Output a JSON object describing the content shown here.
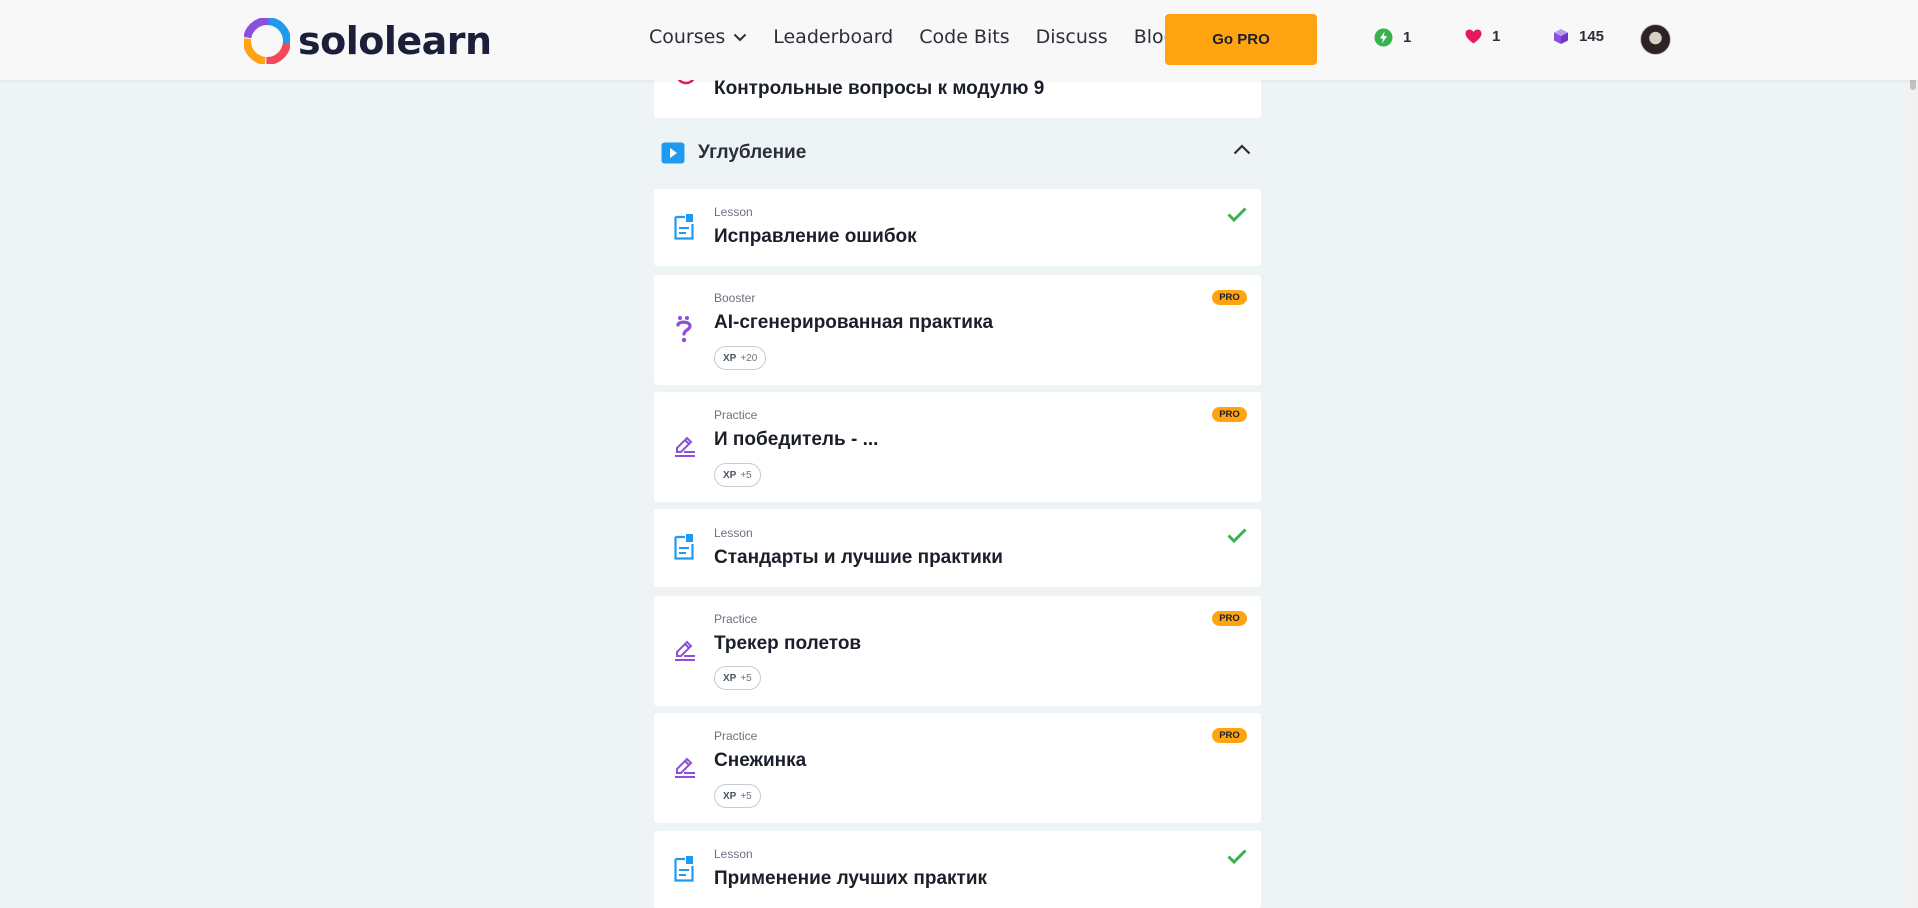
{
  "header": {
    "brand": "sololearn",
    "nav": {
      "courses": "Courses",
      "leaderboard": "Leaderboard",
      "code_bits": "Code Bits",
      "discuss": "Discuss",
      "blog": "Blog"
    },
    "go_pro": "Go PRO",
    "stats": {
      "streak": "1",
      "hearts": "1",
      "bits": "145"
    }
  },
  "previous_card": {
    "title": "Контрольные вопросы к модулю 9"
  },
  "section": {
    "title": "Углубление"
  },
  "items": [
    {
      "type": "Lesson",
      "title": "Исправление ошибок",
      "completed": true,
      "icon": "lesson-icon"
    },
    {
      "type": "Booster",
      "title": "AI-сгенерированная практика",
      "pro": "PRO",
      "xp_label": "XP",
      "xp_value": "+20",
      "icon": "question-icon"
    },
    {
      "type": "Practice",
      "title": "И победитель - ...",
      "pro": "PRO",
      "xp_label": "XP",
      "xp_value": "+5",
      "icon": "pencil-icon"
    },
    {
      "type": "Lesson",
      "title": "Стандарты и лучшие практики",
      "completed": true,
      "icon": "lesson-icon"
    },
    {
      "type": "Practice",
      "title": "Трекер полетов",
      "pro": "PRO",
      "xp_label": "XP",
      "xp_value": "+5",
      "icon": "pencil-icon"
    },
    {
      "type": "Practice",
      "title": "Снежинка",
      "pro": "PRO",
      "xp_label": "XP",
      "xp_value": "+5",
      "icon": "pencil-icon"
    },
    {
      "type": "Lesson",
      "title": "Применение лучших практик",
      "completed": true,
      "icon": "lesson-icon"
    }
  ],
  "colors": {
    "accent_orange": "#ffa310",
    "check_green": "#37b24d",
    "lesson_blue": "#1e9bf0",
    "practice_purple": "#8b4fd9",
    "background": "#eef3f6"
  }
}
